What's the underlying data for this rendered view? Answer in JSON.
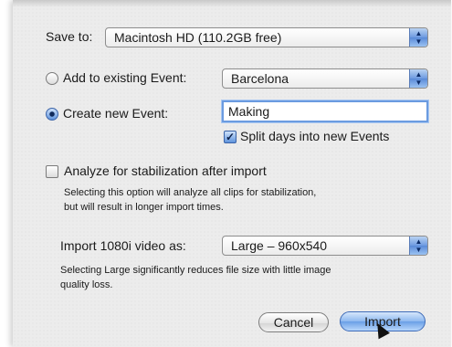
{
  "save_to": {
    "label": "Save to:",
    "value": "Macintosh HD (110.2GB free)"
  },
  "add_existing": {
    "label": "Add to existing Event:",
    "value": "Barcelona",
    "selected": false
  },
  "create_new": {
    "label": "Create new Event:",
    "value": "Making",
    "selected": true
  },
  "split_days": {
    "label": "Split days into new Events",
    "checked": true
  },
  "stabilization": {
    "label": "Analyze for stabilization after import",
    "checked": false,
    "help_line1": "Selecting this option will analyze all clips for stabilization,",
    "help_line2": "but will result in longer import times."
  },
  "import_1080i": {
    "label": "Import 1080i video as:",
    "value": "Large – 960x540",
    "help_line1": "Selecting Large significantly reduces file size with little image",
    "help_line2": "quality loss."
  },
  "buttons": {
    "cancel": "Cancel",
    "import": "Import"
  },
  "colors": {
    "accent": "#6d9ae0",
    "background": "#ececec"
  },
  "icons": {
    "popup": "up-down-arrows-icon",
    "check": "checkmark-icon",
    "cursor": "mouse-pointer-icon"
  }
}
